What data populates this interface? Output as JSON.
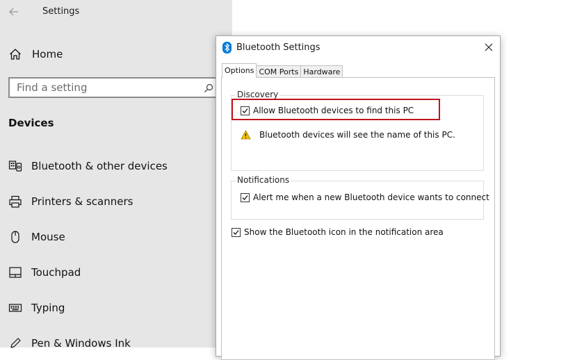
{
  "settings": {
    "title": "Settings",
    "home_label": "Home",
    "search_placeholder": "Find a setting",
    "section_title": "Devices",
    "nav_items": [
      {
        "label": "Bluetooth & other devices",
        "icon": "bluetooth-devices-icon"
      },
      {
        "label": "Printers & scanners",
        "icon": "printer-icon"
      },
      {
        "label": "Mouse",
        "icon": "mouse-icon"
      },
      {
        "label": "Touchpad",
        "icon": "touchpad-icon"
      },
      {
        "label": "Typing",
        "icon": "keyboard-icon"
      },
      {
        "label": "Pen & Windows Ink",
        "icon": "pen-icon"
      }
    ]
  },
  "dialog": {
    "title": "Bluetooth Settings",
    "tabs": [
      {
        "label": "Options",
        "active": true
      },
      {
        "label": "COM Ports",
        "active": false
      },
      {
        "label": "Hardware",
        "active": false
      }
    ],
    "discovery": {
      "group_label": "Discovery",
      "allow_label": "Allow Bluetooth devices to find this PC",
      "allow_checked": true,
      "warning_text": "Bluetooth devices will see the name of this PC."
    },
    "notifications": {
      "group_label": "Notifications",
      "alert_label": "Alert me when a new Bluetooth device wants to connect",
      "alert_checked": true
    },
    "show_icon_label": "Show the Bluetooth icon in the notification area",
    "show_icon_checked": true
  },
  "colors": {
    "settings_bg": "#e6e6e6",
    "highlight": "#c0141c",
    "bluetooth_blue": "#0078d7",
    "warning_yellow": "#f5c400"
  }
}
